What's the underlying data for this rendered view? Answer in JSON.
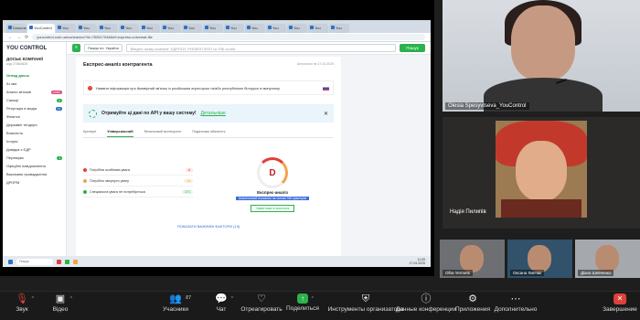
{
  "meeting": {
    "speaker_name": "Olesia Spesyvtseva_YouControl",
    "participant_2_name": "Надія Пилипів",
    "participants_small": [
      "Olha Yermets",
      "Оксана Линчак",
      "Діана Шевченко"
    ]
  },
  "browser": {
    "tabs": [
      "Dokumentacja",
      "YouControl",
      "You",
      "You",
      "You",
      "You",
      "You",
      "You",
      "You",
      "You",
      "You",
      "You",
      "You",
      "You",
      "You",
      "You"
    ],
    "url": "youcontrol.com.ua/contractor/?id=752617048&#f=express-universal-file",
    "nav_icons": [
      "←",
      "→",
      "⟳"
    ]
  },
  "app": {
    "logo": "YOU CONTROL",
    "company": "ДОСЬЄ КОМПАНІЇ",
    "company_sub": "код: 27464525",
    "sidebar": [
      {
        "label": "Огляд досьє",
        "count": "",
        "active": true
      },
      {
        "label": "AI звіт",
        "count": "",
        "active": false
      },
      {
        "label": "Аналіз зв'язків",
        "count": "НОВА",
        "active": false
      },
      {
        "label": "Санкції",
        "count": "0",
        "active": false
      },
      {
        "label": "Репутація в медіа",
        "count": "74",
        "active": false
      },
      {
        "label": "Фінанси",
        "count": "",
        "active": false
      },
      {
        "label": "Державні тендери",
        "count": "",
        "active": false
      },
      {
        "label": "Власність",
        "count": "",
        "active": false
      },
      {
        "label": "Історія",
        "count": "",
        "active": false
      },
      {
        "label": "Довідка з ЄДР",
        "count": "",
        "active": false
      },
      {
        "label": "Перевірки",
        "count": "1",
        "active": false
      },
      {
        "label": "Офіційні повідомлення",
        "count": "",
        "active": false
      },
      {
        "label": "Виконавчі провадження",
        "count": "",
        "active": false
      },
      {
        "label": "ДРОРМ",
        "count": "",
        "active": false
      }
    ],
    "topbar": {
      "search_scope": "Пошук по",
      "country": "Україна",
      "search_placeholder": "Введіть назву компанії, ЄДРПОУ, РНОКПП ФОП чи ПІБ особи",
      "search_button": "Пошук"
    },
    "card": {
      "title": "Експрес-аналіз контрагента",
      "updated": "Актуально на 17.04.2025",
      "sanction_text": "Наявна інформація про ймовірний зв'язок із російським агресором та/або республікою білорусь в минулому",
      "api_text": "Отримуйте ці дані по API у вашу систему!",
      "api_more": "Детальніше",
      "close": "✕",
      "tabs": [
        "Критерії",
        "Універсальний",
        "Фінансовий моніторинг",
        "Податкова обачність"
      ],
      "risks": [
        {
          "label": "Потрібна особлива увага",
          "count": "6",
          "color": "#e0403a",
          "bg": "#fde4e2"
        },
        {
          "label": "Потрібно звернути увагу",
          "count": "13",
          "color": "#f2a34a",
          "bg": "#fdefdc"
        },
        {
          "label": "Спеціальна увага не потребується",
          "count": "371",
          "color": "#2bb24c",
          "bg": "#e3f5e7"
        }
      ],
      "grade": "D",
      "grade_label": "Експрес-аналіз",
      "grade_note": "Аналітичний показник на основі 390 факторів",
      "download": "Завантажити висновок",
      "show_all": "ПОКАЗАТИ ВАЖЛИВІ ФАКТОРИ (19)"
    },
    "taskbar": {
      "search": "Пошук",
      "time": "11:09",
      "date": "17.04.2025"
    }
  },
  "toolbar": [
    {
      "label": "Звук",
      "icon": "mic-muted-icon",
      "glyph": "🎙",
      "caret": true,
      "badge": ""
    },
    {
      "label": "Відео",
      "icon": "video-icon",
      "glyph": "▣",
      "caret": true,
      "badge": ""
    },
    {
      "label": "Учасники",
      "icon": "participants-icon",
      "glyph": "👥",
      "caret": true,
      "badge": "27"
    },
    {
      "label": "Чат",
      "icon": "chat-icon",
      "glyph": "💬",
      "caret": true,
      "badge": ""
    },
    {
      "label": "Отреагировать",
      "icon": "heart-icon",
      "glyph": "♡",
      "caret": false,
      "badge": ""
    },
    {
      "label": "Поделиться",
      "icon": "share-screen-icon",
      "glyph": "↑",
      "caret": true,
      "badge": ""
    },
    {
      "label": "Инструменты организатора",
      "icon": "shield-icon",
      "glyph": "⛨",
      "caret": false,
      "badge": ""
    },
    {
      "label": "Данные конференции",
      "icon": "info-icon",
      "glyph": "ⓘ",
      "caret": false,
      "badge": ""
    },
    {
      "label": "Приложения",
      "icon": "apps-icon",
      "glyph": "⚙",
      "caret": false,
      "badge": ""
    },
    {
      "label": "Дополнительно",
      "icon": "more-icon",
      "glyph": "⋯",
      "caret": false,
      "badge": ""
    },
    {
      "label": "Завершение",
      "icon": "end-call-icon",
      "glyph": "✕",
      "caret": false,
      "badge": ""
    }
  ]
}
